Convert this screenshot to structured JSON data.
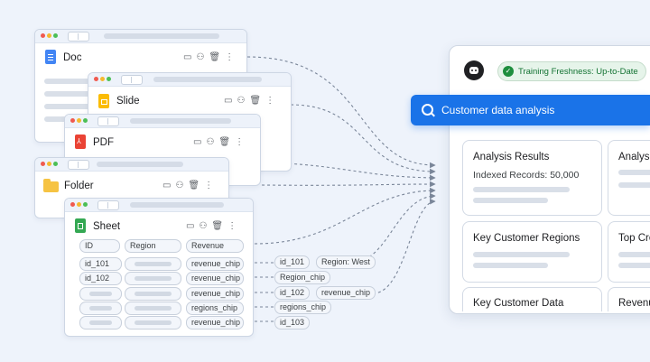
{
  "sources": {
    "doc": {
      "title": "Doc"
    },
    "slide": {
      "title": "Slide"
    },
    "pdf": {
      "title": "PDF"
    },
    "folder": {
      "title": "Folder"
    },
    "sheet": {
      "title": "Sheet",
      "headers": [
        "ID",
        "Region",
        "Revenue"
      ],
      "rows": [
        [
          "id_101",
          "",
          "revenue_chip"
        ],
        [
          "id_102",
          "",
          "revenue_chip"
        ],
        [
          "",
          "",
          "revenue_chip"
        ],
        [
          "",
          "",
          "regions_chip"
        ],
        [
          "",
          "",
          "revenue_chip"
        ]
      ]
    }
  },
  "extracted_chips": [
    "id_101",
    "Region: West",
    "Region_chip",
    "id_102",
    "revenue_chip",
    "regions_chip",
    "id_103"
  ],
  "app": {
    "status_badge": "Training Freshness: Up-to-Date",
    "search_query": "Customer data analysis",
    "cards": [
      {
        "title": "Analysis Results",
        "subtitle": "Indexed Records: 50,000"
      },
      {
        "title": "Analysis"
      },
      {
        "title": "Key Customer Regions"
      },
      {
        "title": "Top Cro"
      },
      {
        "title": "Key Customer Data"
      },
      {
        "title": "Revenu"
      }
    ]
  },
  "icons": [
    "doc-icon",
    "slide-icon",
    "pdf-icon",
    "folder-icon",
    "sheet-icon",
    "robot-icon",
    "check-icon",
    "search-icon",
    "folder-action-icon",
    "share-icon",
    "trash-icon",
    "more-icon"
  ],
  "colors": {
    "accent": "#1a73e8",
    "badge_bg": "#e6f4ea",
    "badge_text": "#137333"
  }
}
